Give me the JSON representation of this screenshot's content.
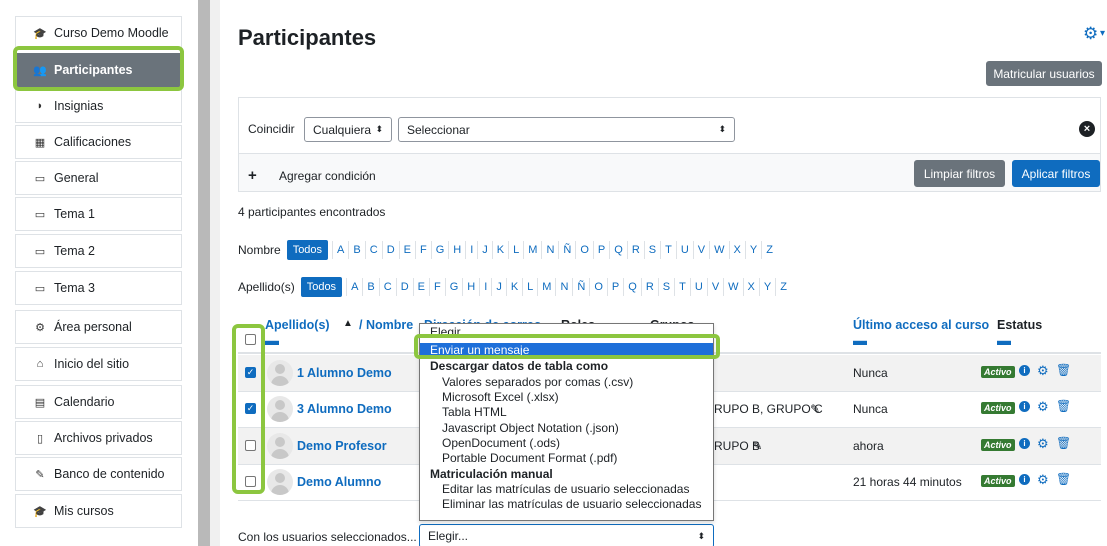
{
  "sidebar": {
    "items": [
      {
        "icon": "graduation-cap-icon",
        "glyph": "🎓",
        "label": "Curso Demo Moodle",
        "active": false
      },
      {
        "icon": "users-icon",
        "glyph": "👥",
        "label": "Participantes",
        "active": true
      },
      {
        "icon": "shield-icon",
        "glyph": "◗",
        "label": "Insignias",
        "active": false
      },
      {
        "icon": "table-icon",
        "glyph": "▦",
        "label": "Calificaciones",
        "active": false
      },
      {
        "icon": "folder-icon",
        "glyph": "▭",
        "label": "General",
        "active": false
      },
      {
        "icon": "folder-icon",
        "glyph": "▭",
        "label": "Tema 1",
        "active": false
      },
      {
        "icon": "folder-icon",
        "glyph": "▭",
        "label": "Tema 2",
        "active": false
      },
      {
        "icon": "folder-icon",
        "glyph": "▭",
        "label": "Tema 3",
        "active": false
      },
      {
        "icon": "dashboard-icon",
        "glyph": "⚙",
        "label": "Área personal",
        "active": false
      },
      {
        "icon": "home-icon",
        "glyph": "⌂",
        "label": "Inicio del sitio",
        "active": false
      },
      {
        "icon": "calendar-icon",
        "glyph": "▤",
        "label": "Calendario",
        "active": false
      },
      {
        "icon": "file-icon",
        "glyph": "▯",
        "label": "Archivos privados",
        "active": false
      },
      {
        "icon": "pencil-icon",
        "glyph": "✎",
        "label": "Banco de contenido",
        "active": false
      },
      {
        "icon": "graduation-cap-icon",
        "glyph": "🎓",
        "label": "Mis cursos",
        "active": false
      }
    ]
  },
  "page": {
    "title": "Participantes",
    "enrol_button": "Matricular usuarios"
  },
  "filters": {
    "match_label": "Coincidir",
    "match_value": "Cualquiera",
    "type_placeholder": "Seleccionar",
    "add_condition": "Agregar condición",
    "clear_button": "Limpiar filtros",
    "apply_button": "Aplicar filtros"
  },
  "results": {
    "count_text": "4 participantes encontrados"
  },
  "initials": {
    "first_label": "Nombre",
    "last_label": "Apellido(s)",
    "all": "Todos",
    "letters": [
      "A",
      "B",
      "C",
      "D",
      "E",
      "F",
      "G",
      "H",
      "I",
      "J",
      "K",
      "L",
      "M",
      "N",
      "Ñ",
      "O",
      "P",
      "Q",
      "R",
      "S",
      "T",
      "U",
      "V",
      "W",
      "X",
      "Y",
      "Z"
    ]
  },
  "table": {
    "headers": {
      "name_sort": "Apellido(s)",
      "name_sep": "/ Nombre",
      "email": "Dirección de correo",
      "roles": "Roles",
      "groups": "Grupos",
      "last_access": "Último acceso al curso",
      "status": "Estatus"
    },
    "rows": [
      {
        "checked": true,
        "name": "1 Alumno Demo",
        "groups": "",
        "last_access": "Nunca",
        "status": "Activo"
      },
      {
        "checked": true,
        "name": "3 Alumno Demo",
        "groups": "RUPO B, GRUPO C",
        "last_access": "Nunca",
        "status": "Activo"
      },
      {
        "checked": false,
        "name": "Demo Profesor",
        "groups": "RUPO B",
        "last_access": "ahora",
        "status": "Activo"
      },
      {
        "checked": false,
        "name": "Demo Alumno",
        "groups": "",
        "last_access": "21 horas 44 minutos",
        "status": "Activo"
      }
    ]
  },
  "bulk": {
    "label": "Con los usuarios seleccionados...",
    "select_value": "Elegir...",
    "options": [
      {
        "kind": "opt0",
        "text": "Elegir..."
      },
      {
        "kind": "selected",
        "text": "Enviar un mensaje"
      },
      {
        "kind": "group",
        "text": "Descargar datos de tabla como"
      },
      {
        "kind": "opt",
        "text": "Valores separados por comas (.csv)"
      },
      {
        "kind": "opt",
        "text": "Microsoft Excel (.xlsx)"
      },
      {
        "kind": "opt",
        "text": "Tabla HTML"
      },
      {
        "kind": "opt",
        "text": "Javascript Object Notation (.json)"
      },
      {
        "kind": "opt",
        "text": "OpenDocument (.ods)"
      },
      {
        "kind": "opt",
        "text": "Portable Document Format (.pdf)"
      },
      {
        "kind": "group",
        "text": "Matriculación manual"
      },
      {
        "kind": "opt",
        "text": "Editar las matrículas de usuario seleccionadas"
      },
      {
        "kind": "opt",
        "text": "Eliminar las matrículas de usuario seleccionadas"
      }
    ]
  },
  "colors": {
    "highlight": "#8cc63f",
    "link": "#0f6cbf",
    "active_badge": "#357a32"
  }
}
